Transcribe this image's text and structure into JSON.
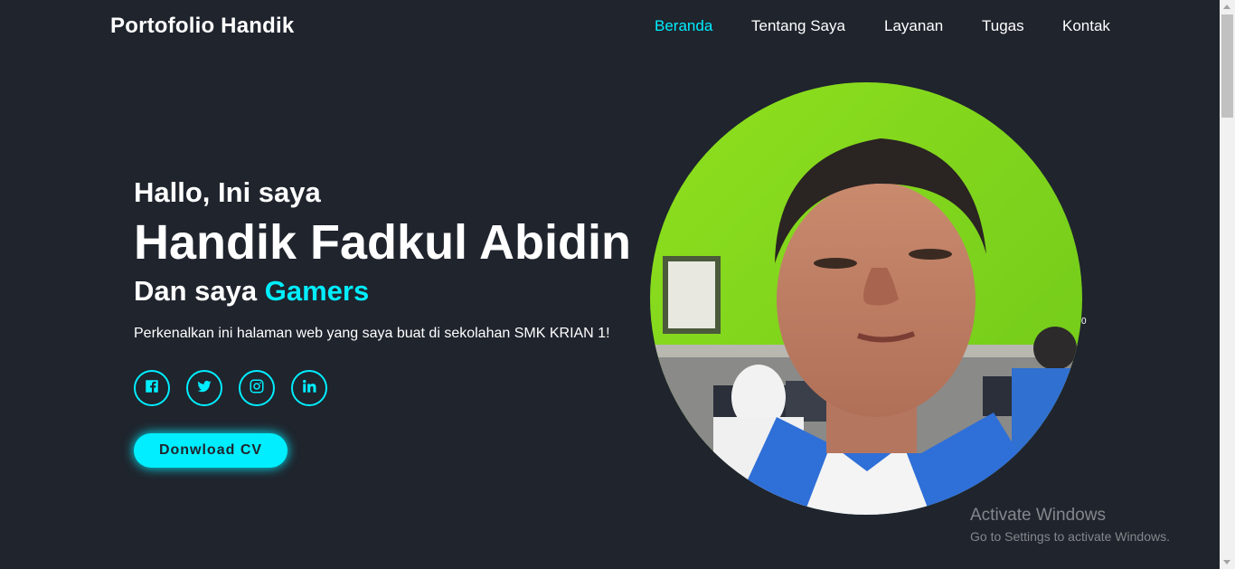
{
  "header": {
    "logo": "Portofolio Handik",
    "nav": [
      {
        "label": "Beranda",
        "active": true
      },
      {
        "label": "Tentang Saya",
        "active": false
      },
      {
        "label": "Layanan",
        "active": false
      },
      {
        "label": "Tugas",
        "active": false
      },
      {
        "label": "Kontak",
        "active": false
      }
    ]
  },
  "hero": {
    "greeting": "Hallo, Ini saya",
    "name": "Handik Fadkul Abidin",
    "role_prefix": "Dan saya",
    "role_highlight": "Gamers",
    "intro": "Perkenalkan ini halaman web yang saya buat di sekolahan SMK KRIAN 1!",
    "socials": [
      "facebook-icon",
      "twitter-icon",
      "instagram-icon",
      "linkedin-icon"
    ],
    "cv_button": "Donwload CV",
    "stray_text": "0"
  },
  "colors": {
    "background": "#1f242d",
    "accent": "#00eeff",
    "text": "#ffffff"
  },
  "watermark": {
    "title": "Activate Windows",
    "subtitle": "Go to Settings to activate Windows."
  }
}
